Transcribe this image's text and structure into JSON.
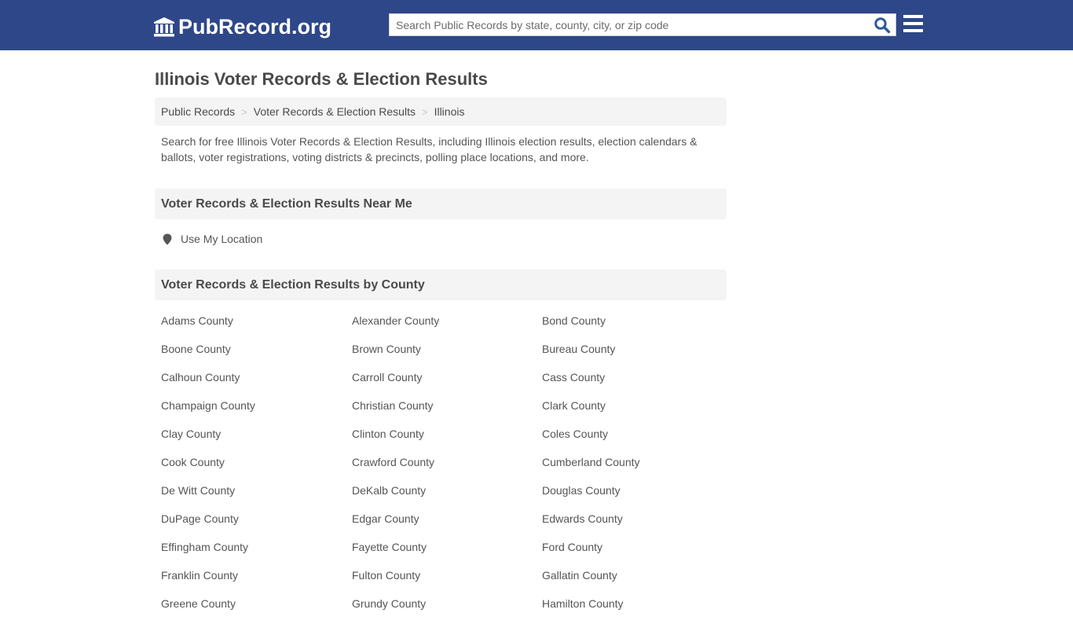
{
  "header": {
    "logo_text": "PubRecord.org",
    "logo_icon": "courthouse-icon",
    "search_placeholder": "Search Public Records by state, county, city, or zip code",
    "search_icon": "search-icon",
    "menu_icon": "hamburger-menu-icon",
    "colors": {
      "topbar": "#2e4789",
      "search_icon": "#2e5a9c"
    }
  },
  "page": {
    "title": "Illinois Voter Records & Election Results",
    "breadcrumb": [
      {
        "label": "Public Records"
      },
      {
        "label": "Voter Records & Election Results"
      },
      {
        "label": "Illinois"
      }
    ],
    "breadcrumb_separator": ">",
    "intro": "Search for free Illinois Voter Records & Election Results, including Illinois election results, election calendars & ballots, voter registrations, voting districts & precincts, polling place locations, and more."
  },
  "near_me": {
    "heading": "Voter Records & Election Results Near Me",
    "location_label": "Use My Location",
    "location_icon": "map-marker-icon"
  },
  "by_county": {
    "heading": "Voter Records & Election Results by County",
    "counties": [
      "Adams County",
      "Alexander County",
      "Bond County",
      "Boone County",
      "Brown County",
      "Bureau County",
      "Calhoun County",
      "Carroll County",
      "Cass County",
      "Champaign County",
      "Christian County",
      "Clark County",
      "Clay County",
      "Clinton County",
      "Coles County",
      "Cook County",
      "Crawford County",
      "Cumberland County",
      "De Witt County",
      "DeKalb County",
      "Douglas County",
      "DuPage County",
      "Edgar County",
      "Edwards County",
      "Effingham County",
      "Fayette County",
      "Ford County",
      "Franklin County",
      "Fulton County",
      "Gallatin County",
      "Greene County",
      "Grundy County",
      "Hamilton County"
    ]
  }
}
